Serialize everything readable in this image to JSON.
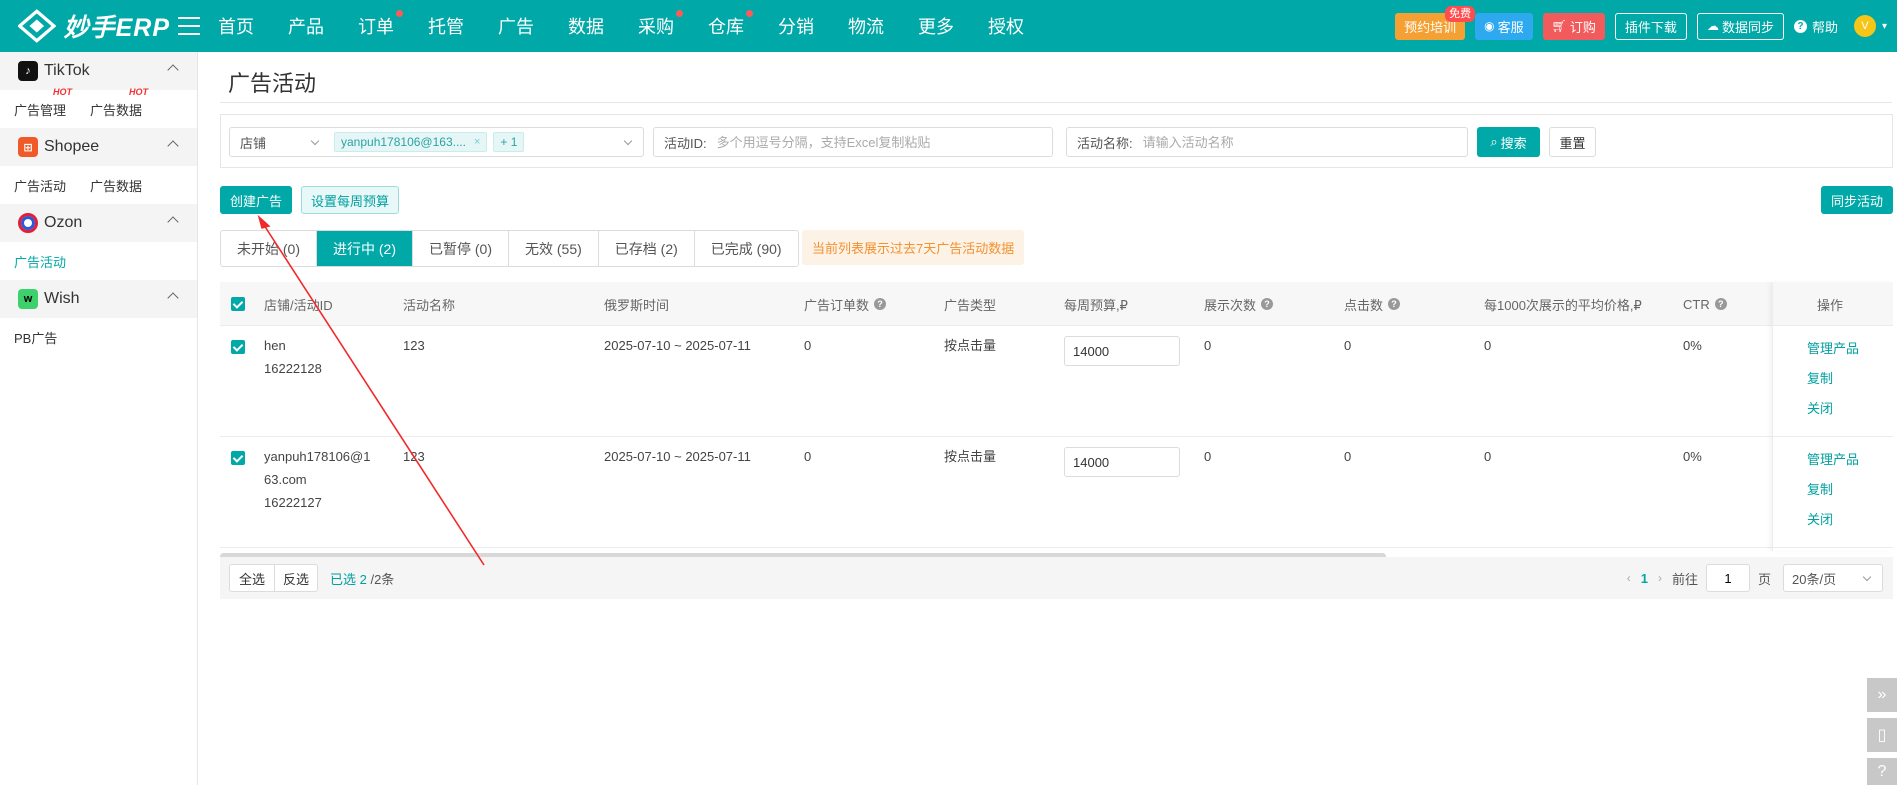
{
  "header": {
    "logo_text": "妙手ERP",
    "nav": [
      {
        "label": "首页",
        "dot": false
      },
      {
        "label": "产品",
        "dot": false
      },
      {
        "label": "订单",
        "dot": true
      },
      {
        "label": "托管",
        "dot": false
      },
      {
        "label": "广告",
        "dot": false
      },
      {
        "label": "数据",
        "dot": false
      },
      {
        "label": "采购",
        "dot": true
      },
      {
        "label": "仓库",
        "dot": true
      },
      {
        "label": "分销",
        "dot": false
      },
      {
        "label": "物流",
        "dot": false
      },
      {
        "label": "更多",
        "dot": false
      },
      {
        "label": "授权",
        "dot": false
      }
    ],
    "training_label": "预约培训",
    "training_badge": "免费",
    "service_label": "客服",
    "order_label": "订购",
    "plugin_label": "插件下载",
    "sync_label": "数据同步",
    "help_label": "帮助",
    "avatar_text": "V"
  },
  "sidebar": {
    "platforms": [
      {
        "name": "TikTok",
        "icon": "tiktok-icon",
        "links": [
          {
            "label": "广告管理",
            "hot": "HOT",
            "active": false
          },
          {
            "label": "广告数据",
            "hot": "HOT",
            "active": false
          }
        ]
      },
      {
        "name": "Shopee",
        "icon": "shopee-icon",
        "links": [
          {
            "label": "广告活动",
            "active": false
          },
          {
            "label": "广告数据",
            "active": false
          }
        ]
      },
      {
        "name": "Ozon",
        "icon": "ozon-icon",
        "links": [
          {
            "label": "广告活动",
            "active": true
          }
        ]
      },
      {
        "name": "Wish",
        "icon": "wish-icon",
        "links": [
          {
            "label": "PB广告",
            "active": false
          }
        ]
      }
    ]
  },
  "page": {
    "title": "广告活动",
    "filters": {
      "shop_label": "店铺",
      "shop_tag": "yanpuh178106@163....",
      "shop_more": "+ 1",
      "activity_id_label": "活动ID:",
      "activity_id_placeholder": "多个用逗号分隔，支持Excel复制粘贴",
      "activity_name_label": "活动名称:",
      "activity_name_placeholder": "请输入活动名称",
      "search_label": "搜索",
      "reset_label": "重置"
    },
    "actions": {
      "create_label": "创建广告",
      "weekly_budget_label": "设置每周预算",
      "sync_label": "同步活动"
    },
    "tabs": [
      {
        "label": "未开始 (0)",
        "active": false
      },
      {
        "label": "进行中 (2)",
        "active": true
      },
      {
        "label": "已暂停 (0)",
        "active": false
      },
      {
        "label": "无效 (55)",
        "active": false
      },
      {
        "label": "已存档 (2)",
        "active": false
      },
      {
        "label": "已完成 (90)",
        "active": false
      }
    ],
    "notice": "当前列表展示过去7天广告活动数据",
    "table": {
      "columns": {
        "shop_id": "店铺/活动ID",
        "name": "活动名称",
        "time": "俄罗斯时间",
        "orders": "广告订单数",
        "type": "广告类型",
        "budget": "每周预算,₽",
        "impressions": "展示次数",
        "clicks": "点击数",
        "cpm": "每1000次展示的平均价格,₽",
        "ctr": "CTR",
        "ops": "操作"
      },
      "rows": [
        {
          "shop_line1": "hen",
          "shop_line2": "16222128",
          "shop_line3": "",
          "name": "123",
          "time": "2025-07-10 ~ 2025-07-11",
          "orders": "0",
          "type": "按点击量",
          "budget": "14000",
          "impressions": "0",
          "clicks": "0",
          "cpm": "0",
          "ctr": "0%"
        },
        {
          "shop_line1": "yanpuh178106@1",
          "shop_line2": "63.com",
          "shop_line3": "16222127",
          "name": "123",
          "time": "2025-07-10 ~ 2025-07-11",
          "orders": "0",
          "type": "按点击量",
          "budget": "14000",
          "impressions": "0",
          "clicks": "0",
          "cpm": "0",
          "ctr": "0%"
        }
      ],
      "op_labels": {
        "manage": "管理产品",
        "copy": "复制",
        "close": "关闭"
      }
    },
    "footer": {
      "select_all": "全选",
      "invert": "反选",
      "selected_prefix": "已选 2",
      "selected_total": "/2条",
      "current_page": "1",
      "goto_label": "前往",
      "goto_value": "1",
      "page_unit": "页",
      "page_size": "20条/页"
    }
  },
  "colors": {
    "brand": "#00a8a8",
    "annotation_arrow": "#f02a2a"
  }
}
